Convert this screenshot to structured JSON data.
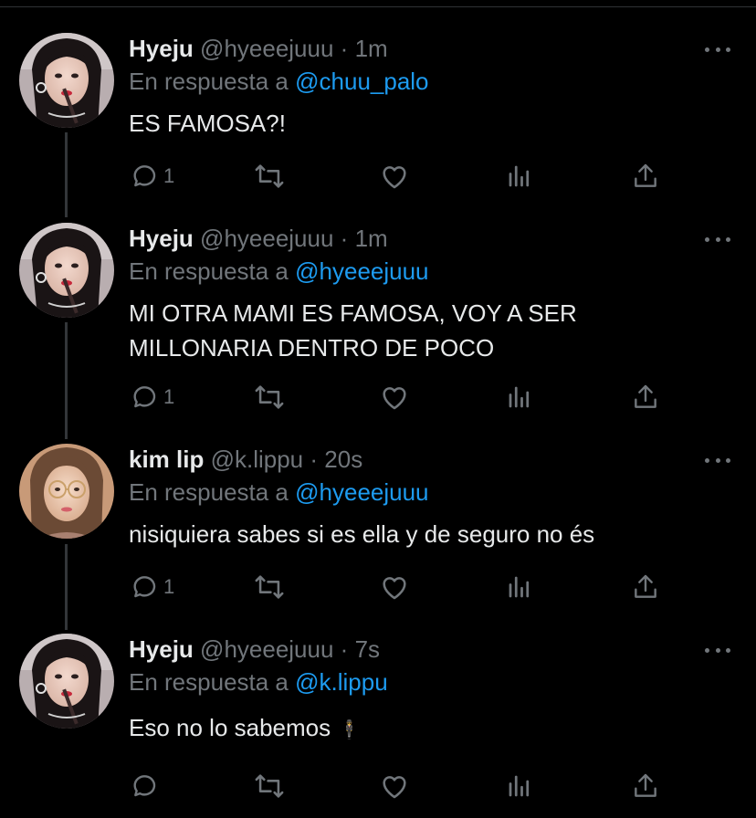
{
  "colors": {
    "background": "#000000",
    "text": "#e7e9ea",
    "secondary": "#71767b",
    "accent": "#1d9bf0"
  },
  "tweets": [
    {
      "name": "Hyeju",
      "handle": "@hyeeejuuu",
      "time": "1m",
      "reply_prefix": "En respuesta a",
      "reply_to": "@chuu_palo",
      "text_lines": [
        "ES FAMOSA?!"
      ],
      "reply_count": "1",
      "icons": [
        "reply-icon",
        "retweet-icon",
        "like-icon",
        "analytics-icon",
        "share-icon",
        "more-icon"
      ]
    },
    {
      "name": "Hyeju",
      "handle": "@hyeeejuuu",
      "time": "1m",
      "reply_prefix": "En respuesta a",
      "reply_to": "@hyeeejuuu",
      "text_lines": [
        "MI OTRA MAMI ES FAMOSA, VOY A SER",
        "MILLONARIA DENTRO DE POCO"
      ],
      "reply_count": "1"
    },
    {
      "name": "kim lip",
      "handle": "@k.lippu",
      "time": "20s",
      "reply_prefix": "En respuesta a",
      "reply_to": "@hyeeejuuu",
      "text_lines": [
        "nisiquiera sabes si es ella y de seguro no és"
      ],
      "reply_count": "1"
    },
    {
      "name": "Hyeju",
      "handle": "@hyeeejuuu",
      "time": "7s",
      "reply_prefix": "En respuesta a",
      "reply_to": "@k.lippu",
      "text_lines": [
        "Eso no lo sabemos"
      ],
      "emoji": "🕴",
      "reply_count": ""
    }
  ]
}
